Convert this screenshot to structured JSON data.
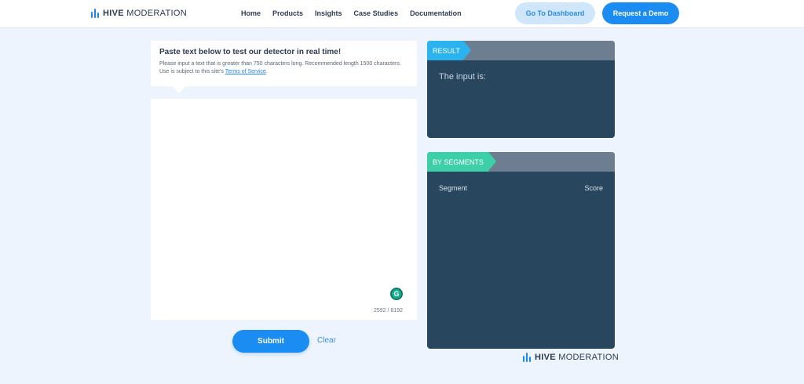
{
  "header": {
    "logo": {
      "brand": "HIVE",
      "product": "MODERATION"
    },
    "nav": [
      "Home",
      "Products",
      "Insights",
      "Case Studies",
      "Documentation"
    ],
    "dashboard_label": "Go To Dashboard",
    "demo_label": "Request a Demo"
  },
  "detector": {
    "title": "Paste text below to test our detector in real time!",
    "description": "Please input a text that is greater than 750 characters long. Recommended length 1500 characters. Use is subject to this site's ",
    "terms_link": "Terms of Service",
    "terms_suffix": ".",
    "input_value": "",
    "char_count": "2592 / 8192",
    "grammarly_letter": "G",
    "submit_label": "Submit",
    "clear_label": "Clear"
  },
  "result_panel": {
    "tag": "RESULT",
    "text": "The input is:"
  },
  "segments_panel": {
    "tag": "BY SEGMENTS",
    "col_segment": "Segment",
    "col_score": "Score"
  },
  "footer": {
    "logo": {
      "brand": "HIVE",
      "product": "MODERATION"
    }
  },
  "colors": {
    "accent": "#1a8cf2",
    "page_bg": "#eef4fd",
    "panel_bg": "#28465e",
    "result_tag": "#2bb3f0",
    "segments_tag": "#3ccfa8"
  }
}
